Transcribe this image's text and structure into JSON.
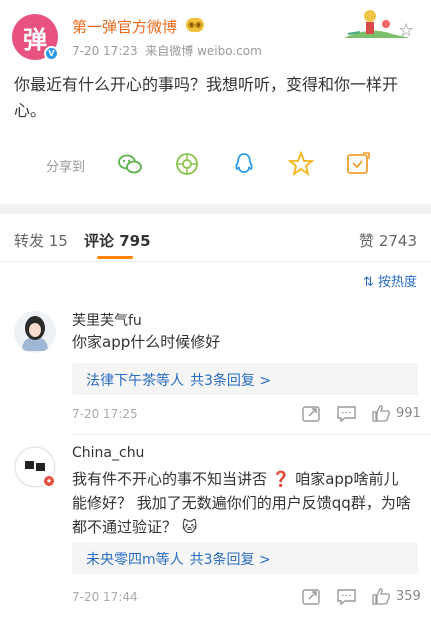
{
  "post": {
    "avatar_char": "弹",
    "author": "第一弹官方微博",
    "time": "7-20 17:23",
    "source": "来自微博 weibo.com",
    "content": "你最近有什么开心的事吗？我想听听，变得和你一样开心。",
    "share_label": "分享到",
    "share_targets": [
      "wechat-icon",
      "moments-icon",
      "qq-icon",
      "qzone-icon",
      "save-icon"
    ]
  },
  "tabs": {
    "repost": "转发 15",
    "comment": "评论 795",
    "like": "赞 2743"
  },
  "sort_label": "按热度",
  "comments": [
    {
      "name": "芙里芙气fu",
      "text": "你家app什么时候修好",
      "reply_names": "法律下午茶等人",
      "reply_more": "共3条回复 >",
      "time": "7-20 17:25",
      "likes": "991"
    },
    {
      "name": "China_chu",
      "text": "我有件不开心的事不知当讲否 ❓ 咱家app啥前儿能修好？ 我加了无数遍你们的用户反馈qq群，为啥都不通过验证？ 🐱",
      "reply_names": "未央零四m等人",
      "reply_more": "共3条回复 >",
      "time": "7-20 17:44",
      "likes": "359"
    }
  ],
  "colors": {
    "accent": "#ff8200",
    "link": "#2a6dc4",
    "author": "#e86b1c",
    "avatar": "#e8527f"
  }
}
